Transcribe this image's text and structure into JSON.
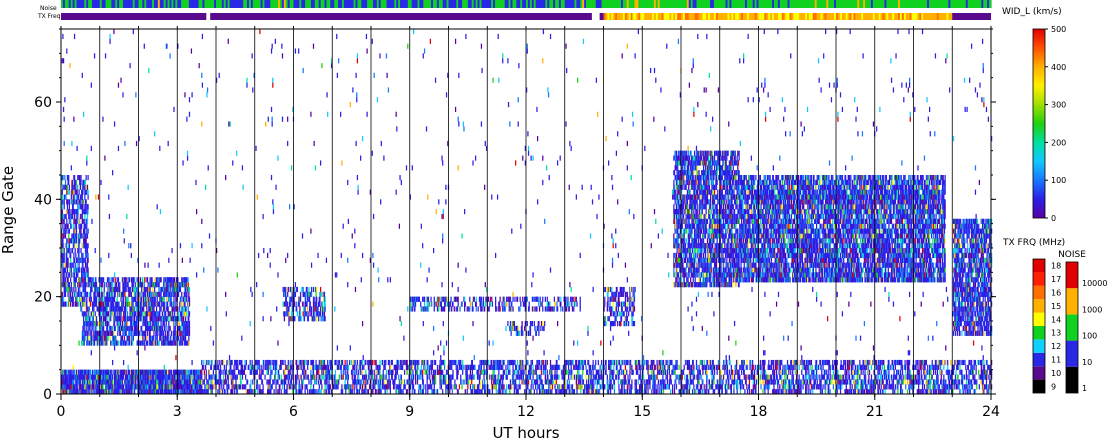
{
  "chart_data": {
    "type": "heatmap",
    "xlabel": "UT hours",
    "ylabel": "Range Gate",
    "xlim": [
      0,
      24
    ],
    "ylim": [
      0,
      75
    ],
    "xticks": [
      "0",
      "3",
      "6",
      "9",
      "12",
      "15",
      "18",
      "21",
      "24"
    ],
    "yticks": [
      "0",
      "20",
      "40",
      "60"
    ],
    "grid": "vertical lines every hour",
    "echo_regions": [
      {
        "t_start": 0.0,
        "t_end": 3.6,
        "gate_min": 0,
        "gate_max": 5,
        "density": 0.85
      },
      {
        "t_start": 0.0,
        "t_end": 0.7,
        "gate_min": 18,
        "gate_max": 45,
        "density": 0.45
      },
      {
        "t_start": 0.5,
        "t_end": 3.3,
        "gate_min": 10,
        "gate_max": 24,
        "density": 0.55
      },
      {
        "t_start": 3.6,
        "t_end": 24.0,
        "gate_min": 0,
        "gate_max": 7,
        "density": 0.4
      },
      {
        "t_start": 5.7,
        "t_end": 6.8,
        "gate_min": 15,
        "gate_max": 22,
        "density": 0.4
      },
      {
        "t_start": 9.0,
        "t_end": 13.4,
        "gate_min": 17,
        "gate_max": 20,
        "density": 0.35
      },
      {
        "t_start": 11.5,
        "t_end": 12.5,
        "gate_min": 12,
        "gate_max": 15,
        "density": 0.35
      },
      {
        "t_start": 14.0,
        "t_end": 14.8,
        "gate_min": 14,
        "gate_max": 22,
        "density": 0.35
      },
      {
        "t_start": 15.8,
        "t_end": 17.5,
        "gate_min": 22,
        "gate_max": 50,
        "density": 0.6
      },
      {
        "t_start": 17.2,
        "t_end": 22.8,
        "gate_min": 23,
        "gate_max": 45,
        "density": 0.65
      },
      {
        "t_start": 23.0,
        "t_end": 24.0,
        "gate_min": 12,
        "gate_max": 36,
        "density": 0.6
      }
    ],
    "scatter_density": 0.025,
    "noise_bar": {
      "label": "Noise",
      "segments": [
        {
          "t_start": 0,
          "t_end": 14,
          "level": "mixed 10-100"
        },
        {
          "t_start": 14,
          "t_end": 24,
          "level": "mostly 100"
        }
      ]
    },
    "freq_bar": {
      "label": "TX Freq",
      "segments": [
        {
          "t_start": 0,
          "t_end": 3.75,
          "mhz": "10"
        },
        {
          "t_start": 3.85,
          "t_end": 13.7,
          "mhz": "10"
        },
        {
          "t_start": 13.9,
          "t_end": 14.0,
          "mhz": "10"
        },
        {
          "t_start": 14.0,
          "t_end": 23.0,
          "mhz": "14-16"
        },
        {
          "t_start": 23.0,
          "t_end": 24,
          "mhz": "10"
        }
      ]
    },
    "colorbars": [
      {
        "title": "WID_L (km/s)",
        "type": "continuous",
        "ticks": [
          "0",
          "100",
          "200",
          "300",
          "400",
          "500"
        ]
      },
      {
        "title": "TX FRQ (MHz)",
        "type": "discrete",
        "ticks": [
          "9",
          "10",
          "11",
          "12",
          "13",
          "14",
          "15",
          "16",
          "17",
          "18"
        ]
      },
      {
        "title": "NOISE",
        "type": "discrete",
        "ticks": [
          "1",
          "10",
          "100",
          "1000",
          "10000"
        ]
      }
    ],
    "colors": {
      "palette_width": [
        "#5a00a0",
        "#2a20e8",
        "#1878ff",
        "#10c8ff",
        "#00e0a0",
        "#20d010",
        "#a0e000",
        "#fff000",
        "#ffb000",
        "#ff5000",
        "#e00000"
      ],
      "freq_levels": [
        "#000000",
        "#5a0a8c",
        "#2828e6",
        "#10d0ff",
        "#10d020",
        "#ffff00",
        "#ffb000",
        "#ff7000",
        "#ff2000",
        "#e00000"
      ],
      "noise_levels": [
        "#000000",
        "#2828e6",
        "#10d020",
        "#ffb000",
        "#e00000"
      ]
    }
  }
}
